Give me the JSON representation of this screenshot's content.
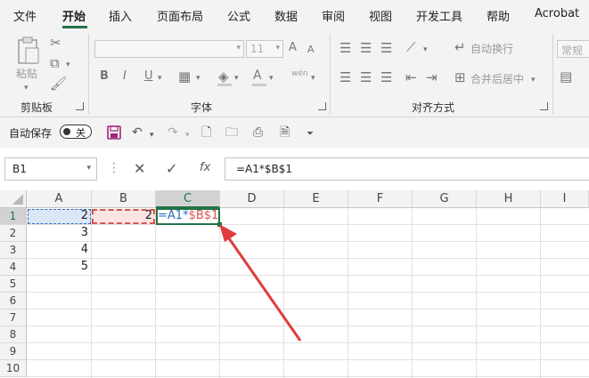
{
  "ribbon_tabs": [
    "文件",
    "开始",
    "插入",
    "页面布局",
    "公式",
    "数据",
    "审阅",
    "视图",
    "开发工具",
    "帮助",
    "Acrobat"
  ],
  "ribbon": {
    "clipboard": {
      "paste_label": "粘贴",
      "group_label": "剪贴板"
    },
    "font": {
      "font_size": "11",
      "group_label": "字体",
      "bold": "B",
      "italic": "I",
      "wen_label": "wén"
    },
    "alignment": {
      "wrap_text": "自动换行",
      "merge_center": "合并后居中",
      "group_label": "对齐方式"
    },
    "number": {
      "format_value": "常规"
    }
  },
  "qat": {
    "autosave_label": "自动保存",
    "toggle_state": "关"
  },
  "formula_bar": {
    "name_box": "B1",
    "fx_label": "fx",
    "formula": "=A1*$B$1"
  },
  "grid": {
    "columns": [
      "A",
      "B",
      "C",
      "D",
      "E",
      "F",
      "G",
      "H",
      "I"
    ],
    "rows": [
      "1",
      "2",
      "3",
      "4",
      "5",
      "6",
      "7",
      "8",
      "9",
      "10"
    ],
    "cells": {
      "A1": "2",
      "A2": "3",
      "A3": "4",
      "A4": "5",
      "B1": "2",
      "C1_prefix": "=A1*",
      "C1_ref": "$B$1"
    }
  },
  "colors": {
    "accent": "#217346",
    "reference_red": "#d9534f",
    "copy_blue": "#2e6bbf"
  }
}
